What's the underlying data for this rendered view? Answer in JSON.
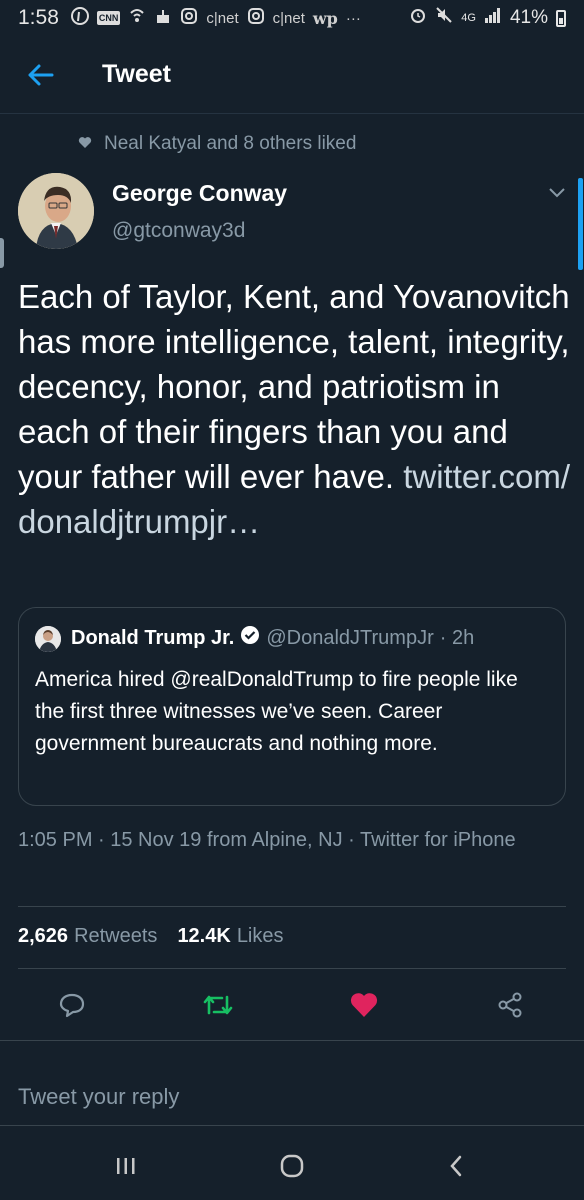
{
  "status_bar": {
    "time": "1:58",
    "notification_icons": [
      "pinterest-icon",
      "cnn-icon",
      "wifi-call-icon",
      "cake-icon",
      "instagram-icon",
      "cnet-icon",
      "instagram-icon",
      "cnet-icon",
      "washington-post-icon"
    ],
    "cnn_label": "CNN",
    "cnet_label_1": "c|net",
    "cnet_label_2": "c|net",
    "wp_label": "wp",
    "more": "···",
    "network": "4G",
    "battery": "41%"
  },
  "header": {
    "title": "Tweet"
  },
  "social_context": {
    "text": "Neal Katyal and 8 others liked"
  },
  "tweet": {
    "author_name": "George Conway",
    "author_handle": "@gtconway3d",
    "text": "Each of Taylor, Kent, and Yovanovitch has more intelligence, talent, integrity, decency, honor, and patriotism in each of their fingers than you and your father will ever have.",
    "link_text": "twitter.com/ donaldjtrumpjr…",
    "meta": "1:05 PM · 15 Nov 19 from Alpine, NJ · Twitter for iPhone"
  },
  "quote": {
    "author_name": "Donald Trump Jr.",
    "author_handle": "@DonaldJTrumpJr",
    "time": "· 2h",
    "text": "America hired @realDonaldTrump to fire people like the first three witnesses we’ve seen. Career government bureaucrats and nothing more."
  },
  "stats": {
    "retweets_count": "2,626",
    "retweets_label": "Retweets",
    "likes_count": "12.4K",
    "likes_label": "Likes"
  },
  "reply": {
    "placeholder": "Tweet your reply"
  },
  "colors": {
    "background": "#15202b",
    "accent": "#1da1f2",
    "retweet_green": "#17bf63",
    "like_pink": "#e0245e",
    "muted": "#8899a6",
    "border": "#38444d"
  }
}
